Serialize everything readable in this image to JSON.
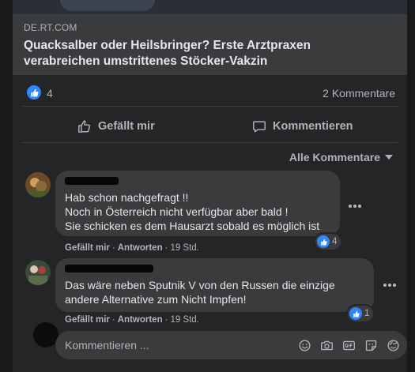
{
  "link": {
    "domain": "DE.RT.COM",
    "title_line1": "Quacksalber oder Heilsbringer? Erste Arztpraxen",
    "title_line2": "verabreichen umstrittenes Stöcker-Vakzin"
  },
  "stats": {
    "likes": "4",
    "comments": "2 Kommentare",
    "reaction_icon": "thumbs-up-icon"
  },
  "actions": {
    "like": "Gefällt mir",
    "comment": "Kommentieren"
  },
  "filter": {
    "label": "Alle Kommentare"
  },
  "comments": [
    {
      "text": "Hab schon nachgefragt !!\nNoch in Österreich nicht verfügbar aber bald !\nSie schicken es dem Hausarzt sobald es möglich ist",
      "reactions": "4",
      "like_label": "Gefällt mir",
      "reply_label": "Antworten",
      "time": "19 Std."
    },
    {
      "text": "Das wäre neben Sputnik V von den Russen die einzige\nandere Alternative zum Nicht Impfen!",
      "reactions": "1",
      "like_label": "Gefällt mir",
      "reply_label": "Antworten",
      "time": "19 Std."
    }
  ],
  "composer": {
    "placeholder": "Kommentieren ...",
    "icons": [
      "emoji-icon",
      "camera-icon",
      "gif-icon",
      "sticker-icon",
      "avatar-sticker-icon"
    ]
  },
  "colors": {
    "background": "#18191a",
    "card": "#242526",
    "bubble": "#3a3b3c",
    "accent": "#2d88ff",
    "text_primary": "#e4e6eb",
    "text_secondary": "#b0b3b8"
  }
}
